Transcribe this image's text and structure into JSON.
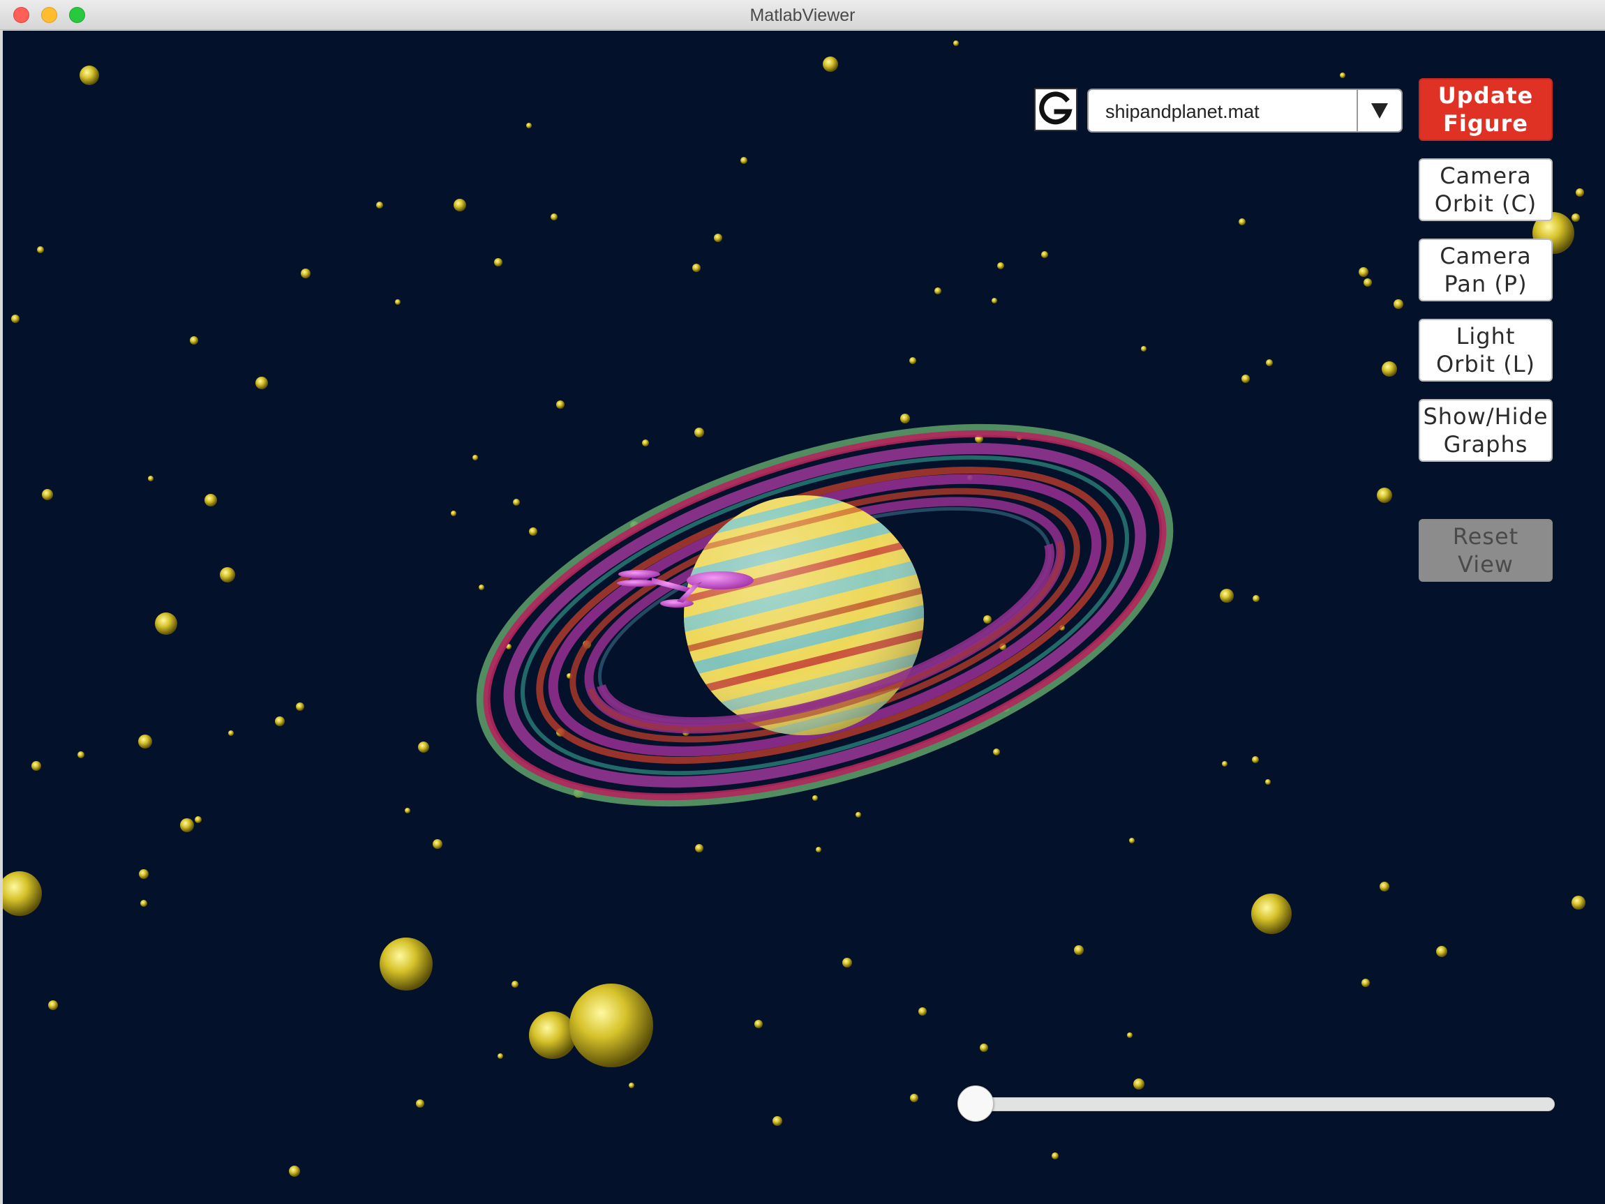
{
  "window": {
    "title": "MatlabViewer"
  },
  "toolbar": {
    "logo_icon": "g-logo-icon",
    "file_select": {
      "value": "shipandplanet.mat",
      "arrow_icon": "triangle-down-icon"
    }
  },
  "buttons": {
    "update": "Update\nFigure",
    "camera_orbit": "Camera\nOrbit (C)",
    "camera_pan": "Camera\nPan (P)",
    "light_orbit": "Light\nOrbit (L)",
    "show_hide": "Show/Hide\nGraphs",
    "reset": "Reset\nView"
  },
  "slider": {
    "value": 0.0
  },
  "colors": {
    "background": "#04112a",
    "update_button": "#e03125",
    "reset_button_disabled": "#8c8c8c",
    "stars": "#d8c52a",
    "ship": "#d24fd6"
  }
}
